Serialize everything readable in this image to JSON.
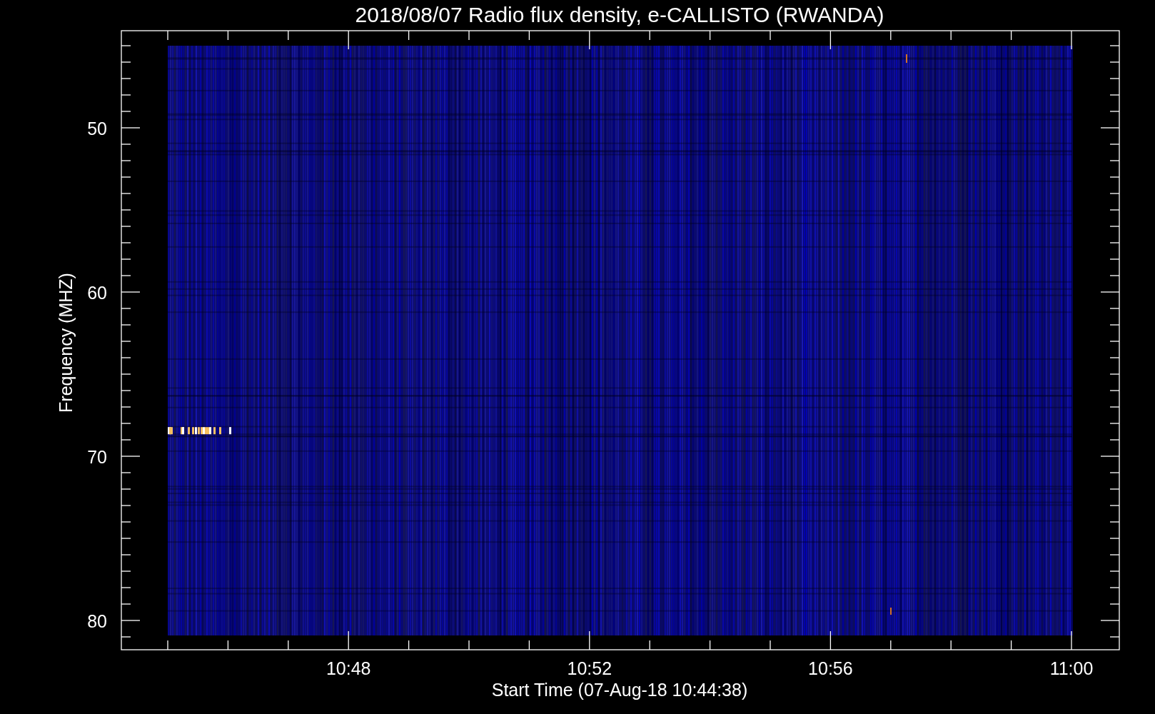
{
  "title": "2018/08/07  Radio flux density, e-CALLISTO (RWANDA)",
  "y_axis": {
    "label": "Frequency (MHZ)",
    "ticks": [
      "50",
      "60",
      "70",
      "80"
    ]
  },
  "x_axis": {
    "label": "Start Time (07-Aug-18 10:44:38)",
    "ticks": [
      "10:48",
      "10:52",
      "10:56",
      "11:00"
    ]
  }
}
